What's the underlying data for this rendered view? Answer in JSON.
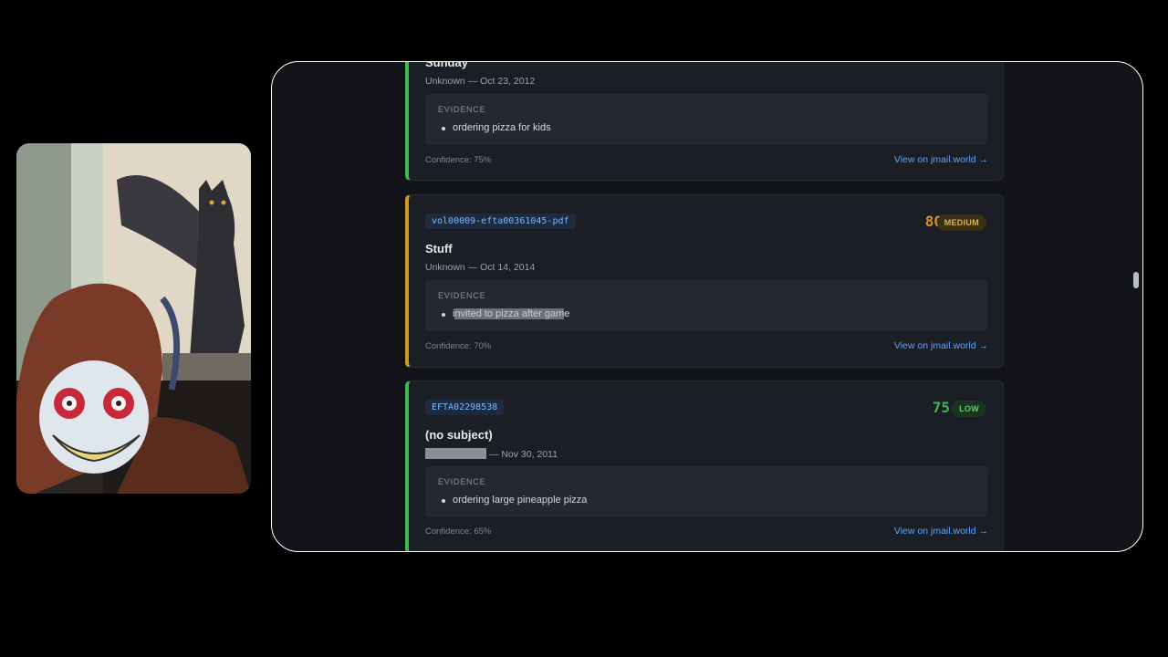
{
  "cards": [
    {
      "subject": "Sunday",
      "sender": "Unknown",
      "date": "Oct 23, 2012",
      "evidence_label": "EVIDENCE",
      "evidence": "ordering pizza for kids",
      "confidence": "Confidence: 75%",
      "link": "View on jmail.world →"
    },
    {
      "doc_id": "vol00009-efta00361045-pdf",
      "score": "80",
      "level": "MEDIUM",
      "subject": "Stuff",
      "sender": "Unknown",
      "date": "Oct 14, 2014",
      "evidence_label": "EVIDENCE",
      "evidence_pre": "i",
      "evidence_hl": "nvited to pizza after gam",
      "evidence_post": "e",
      "confidence": "Confidence: 70%",
      "link": "View on jmail.world →"
    },
    {
      "doc_id": "EFTA02298538",
      "score": "75",
      "level": "LOW",
      "subject": "(no subject)",
      "date": "Nov 30, 2011",
      "evidence_label": "EVIDENCE",
      "evidence": "ordering large pineapple pizza",
      "confidence": "Confidence: 65%",
      "link": "View on jmail.world →"
    }
  ],
  "colors": {
    "medium": "#d29922",
    "low": "#3fb950",
    "link": "#58a6ff"
  }
}
